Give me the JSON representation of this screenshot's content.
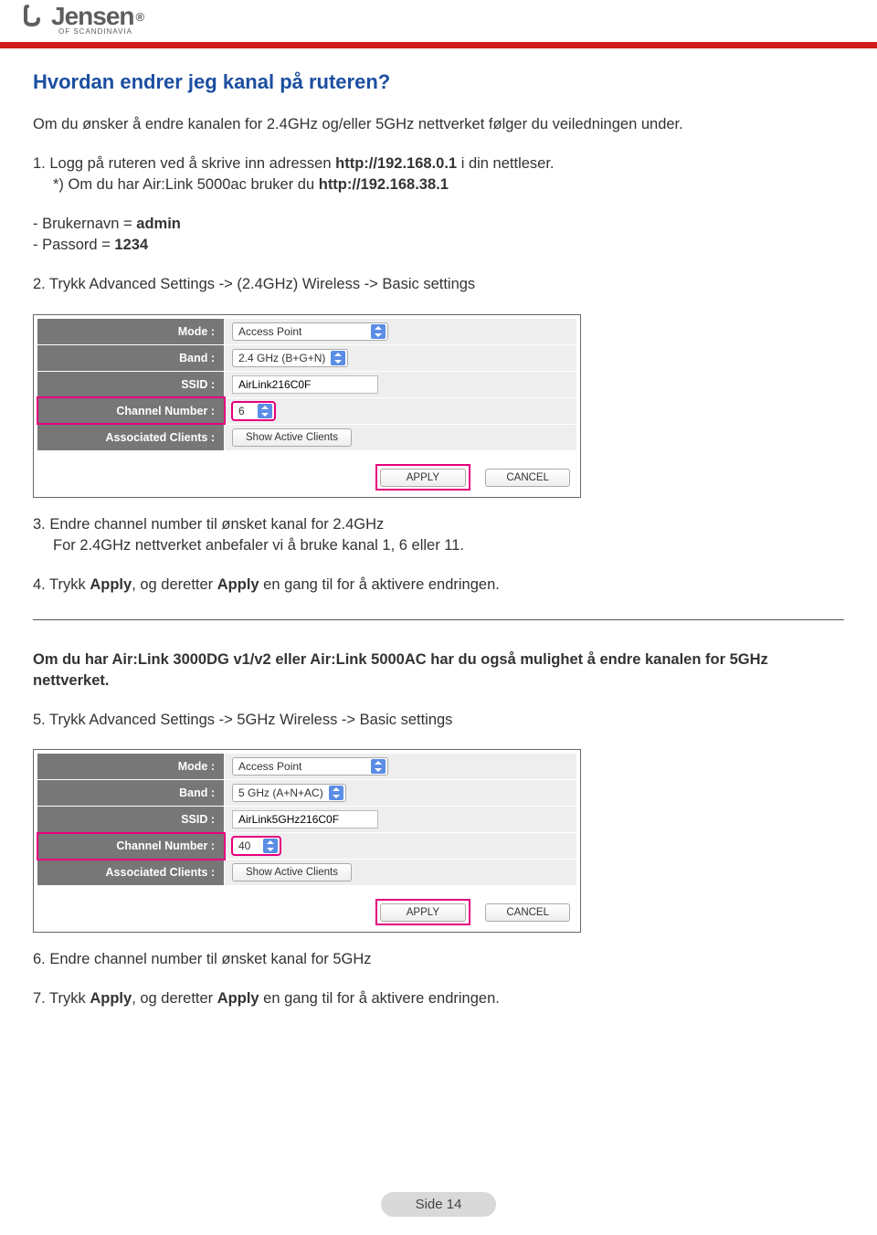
{
  "logo": {
    "main": "Jensen",
    "reg": "®",
    "sub": "OF SCANDINAVIA"
  },
  "title": "Hvordan endrer jeg kanal på ruteren?",
  "intro": "Om du ønsker å endre kanalen for 2.4GHz og/eller 5GHz nettverket følger du veiledningen under.",
  "step1": {
    "prefix": "1. Logg på ruteren ved å skrive inn adressen ",
    "url1": "http://192.168.0.1",
    "mid": " i din nettleser.",
    "line2a": "*) Om du har Air:Link 5000ac bruker du ",
    "url2": "http://192.168.38.1"
  },
  "creds": {
    "user_label": "- Brukernavn = ",
    "user": "admin",
    "pass_label": "- Passord = ",
    "pass": "1234"
  },
  "step2": "2. Trykk Advanced Settings -> (2.4GHz) Wireless -> Basic settings",
  "panel_labels": {
    "mode": "Mode :",
    "band": "Band :",
    "ssid": "SSID :",
    "channel": "Channel Number :",
    "clients": "Associated Clients :"
  },
  "panel1": {
    "mode": "Access Point",
    "band": "2.4 GHz (B+G+N)",
    "ssid": "AirLink216C0F",
    "channel": "6",
    "clients_btn": "Show Active Clients",
    "apply": "APPLY",
    "cancel": "CANCEL"
  },
  "step3": {
    "line1": "3. Endre channel number til ønsket kanal for 2.4GHz",
    "line2": "For 2.4GHz nettverket anbefaler vi å bruke kanal 1, 6 eller 11."
  },
  "step4": {
    "a": "4. Trykk ",
    "b1": "Apply",
    "c": ", og deretter ",
    "b2": "Apply",
    "d": " en gang til for å aktivere endringen."
  },
  "section2_heading": "Om du har Air:Link 3000DG v1/v2 eller Air:Link 5000AC har du også mulighet å endre kanalen  for 5GHz nettverket.",
  "step5": "5. Trykk Advanced Settings -> 5GHz Wireless -> Basic settings",
  "panel2": {
    "mode": "Access Point",
    "band": "5 GHz (A+N+AC)",
    "ssid": "AirLink5GHz216C0F",
    "channel": "40",
    "clients_btn": "Show Active Clients",
    "apply": "APPLY",
    "cancel": "CANCEL"
  },
  "step6": "6. Endre channel number til ønsket kanal for 5GHz",
  "step7": {
    "a": "7. Trykk ",
    "b1": "Apply",
    "c": ", og deretter ",
    "b2": "Apply",
    "d": " en gang til for å aktivere endringen."
  },
  "page_footer": "Side 14"
}
